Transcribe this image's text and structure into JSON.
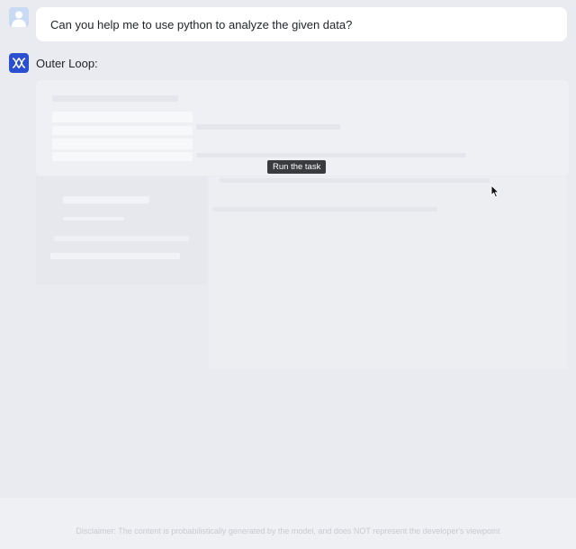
{
  "user_message": {
    "text": "Can you help me to use python to analyze the given data?",
    "avatar_icon": "user-avatar-icon"
  },
  "assistant": {
    "name": "Outer Loop:",
    "icon": "dna-logo-icon",
    "icon_color": "#2b4fd1"
  },
  "tooltip": {
    "text": "Run the task"
  },
  "footer": {
    "disclaimer": "Disclaimer: The content is probabilistically generated by the model, and does NOT represent the developer's viewpoint"
  },
  "colors": {
    "background": "#e9ebf0",
    "bubble": "#ffffff",
    "tooltip_bg": "#3a3b3e"
  }
}
